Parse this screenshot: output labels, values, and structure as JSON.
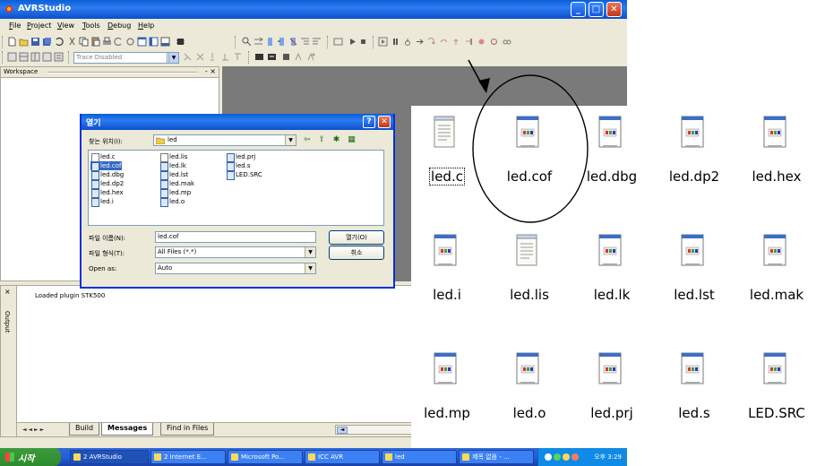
{
  "window": {
    "title": "AVRStudio",
    "controls": {
      "minimize": "_",
      "maximize": "□",
      "close": "✕"
    }
  },
  "menu": [
    "File",
    "Project",
    "View",
    "Tools",
    "Debug",
    "Help"
  ],
  "toolbar": {
    "trace_combo": "Trace Disabled"
  },
  "workspace": {
    "title": "Workspace",
    "controls": "- ×"
  },
  "dialog": {
    "title": "열기",
    "help": "?",
    "close": "✕",
    "look_in_label": "찾는 위치(I):",
    "look_in_value": "led",
    "files_col1": [
      "led.c",
      "led.cof",
      "led.dbg",
      "led.dp2",
      "led.hex",
      "led.i"
    ],
    "files_col2": [
      "led.lis",
      "led.lk",
      "led.lst",
      "led.mak",
      "led.mp",
      "led.o"
    ],
    "files_col3": [
      "led.prj",
      "led.s",
      "LED.SRC"
    ],
    "filename_label": "파일 이름(N):",
    "filename_value": "led.cof",
    "filetype_label": "파일 형식(T):",
    "filetype_value": "All Files (*.*)",
    "openas_label": "Open as:",
    "openas_value": "Auto",
    "open_button": "열기(O)",
    "cancel_button": "취소"
  },
  "output": {
    "side_label": "Output",
    "close": "×",
    "log": "Loaded plugin STK500",
    "tab_nav": "◄ ◄ ► ►",
    "tabs": [
      "Build",
      "Messages",
      "Find in Files"
    ]
  },
  "taskbar": {
    "start": "시작",
    "tasks": [
      "2 AVRStudio",
      "2 Internet E...",
      "Microsoft Po...",
      "ICC AVR",
      "led",
      "제목 없음 - ..."
    ],
    "clock": "오후 3:29"
  },
  "explorer": {
    "files": [
      "led.c",
      "led.cof",
      "led.dbg",
      "led.dp2",
      "led.hex",
      "led.i",
      "led.lis",
      "led.lk",
      "led.lst",
      "led.mak",
      "led.mp",
      "led.o",
      "led.prj",
      "led.s",
      "LED.SRC"
    ],
    "text_files": [
      "led.c",
      "led.lis"
    ],
    "focused": "led.c",
    "highlighted": "led.cof"
  },
  "colors": {
    "title_blue": "#0a5fd8",
    "selection": "#316ac5",
    "annotation": "#000000"
  }
}
